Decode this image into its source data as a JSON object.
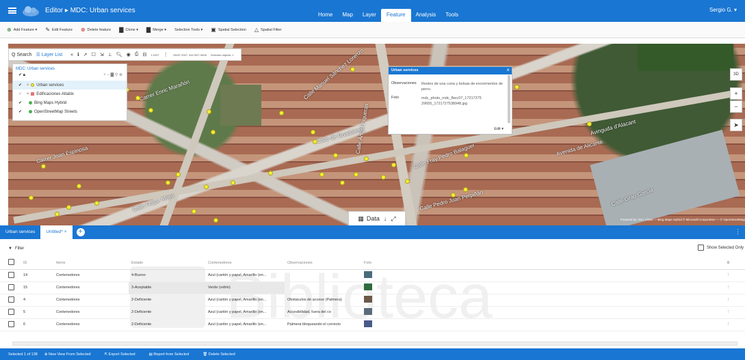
{
  "topbar": {
    "breadcrumb": "Editor ▸ MDC: Urban services",
    "nav": [
      "Home",
      "Map",
      "Layer",
      "Feature",
      "Analysis",
      "Tools"
    ],
    "active_nav": "Feature",
    "user": "Sergio G. ▾"
  },
  "toolbar": [
    {
      "icon": "plus-circle-icon",
      "label": "Add Feature ▾",
      "color": "#2e7d32"
    },
    {
      "icon": "pencil-icon",
      "label": "Edit Feature",
      "color": "#333333"
    },
    {
      "icon": "delete-circle-icon",
      "label": "Delete feature",
      "color": "#d32f2f"
    },
    {
      "icon": "clone-icon",
      "label": "Clone ▾",
      "color": "#333333"
    },
    {
      "icon": "merge-icon",
      "label": "Merge ▾",
      "color": "#333333"
    },
    {
      "icon": "selection-icon",
      "label": "Selection Tools ▾",
      "color": "#333333"
    },
    {
      "icon": "spatial-selection-icon",
      "label": "Spatial Selection",
      "color": "#333333"
    },
    {
      "icon": "spatial-filter-icon",
      "label": "Spatial Filter",
      "color": "#333333"
    }
  ],
  "maptools": {
    "search": "Q Search",
    "layer_list": "Layer List",
    "scale": "1:2257",
    "coords": "-78497.3307, 4617827.9628",
    "selected_objects": "Selected objects: 1"
  },
  "layer_panel": {
    "title": "MDC: Urban services",
    "layers": [
      {
        "name": "Urban services",
        "checked": true,
        "selected": true,
        "swatch": "#f2f230"
      },
      {
        "name": "Edificaciones Altabix",
        "checked": false,
        "selected": false,
        "swatch": "#e57373"
      },
      {
        "name": "Bing Maps Hybrid",
        "checked": true,
        "selected": false,
        "swatch": "#4caf50"
      },
      {
        "name": "OpenStreetMap Streets",
        "checked": true,
        "selected": false,
        "swatch": "#4caf50"
      }
    ]
  },
  "map_labels": [
    "Carrer Enric Marañón",
    "Calle Manuel Sánchez Lorenzo",
    "Calle Ángel Piqueras",
    "Calle de Guadalete",
    "Carrer Joan Espinosa",
    "Calle Felipe Moya",
    "Calle Fray Pedro Balaguer",
    "Avinguda d'Alacant",
    "Avenida de Alicante",
    "Calle Grau García",
    "Calle Pedro Juan Perpiñán"
  ],
  "popup": {
    "title": "Urban services",
    "rows": [
      {
        "key": "Observaciones",
        "value": "Restos de una cuna y bolsas de excrementos de perro."
      },
      {
        "key": "Foto",
        "value": "mdc_photo_mdc_fbec07_17217275 29655_1721727538948.jpg"
      }
    ],
    "edit": "Edit ▾"
  },
  "right_controls": [
    "3D",
    "+",
    "−",
    "➤"
  ],
  "data_toggle": "Data",
  "attribution": "Powered by: Esri, Chart — Bing Maps Hybrid © Microsoft Corporation — © OpenStreetMap",
  "tabs": {
    "items": [
      "Urban services",
      "Untitled* ×"
    ],
    "active": "Untitled* ×"
  },
  "filter": {
    "label": "Filter",
    "show_selected": "Show Selected Only"
  },
  "table": {
    "columns": [
      "ID",
      "Items",
      "Estado",
      "Contenedores",
      "Observaciones",
      "Foto"
    ],
    "rows": [
      {
        "id": "14",
        "items": "Contenedores",
        "estado": "4-Bueno",
        "contenedores": "Azul (cartón y papel, Amarillo (en...",
        "observaciones": "",
        "foto_color": "#4a6b7a"
      },
      {
        "id": "15",
        "items": "Contenedores",
        "estado": "3-Aceptable",
        "contenedores": "Verde (vidrio)",
        "observaciones": "",
        "foto_color": "#2e6b3e"
      },
      {
        "id": "4",
        "items": "Contenedores",
        "estado": "2-Deficiente",
        "contenedores": "Azul (cartón y papel, Amarillo (en...",
        "observaciones": "Obstaculos de acceso (Palmera)",
        "foto_color": "#6b5a4a"
      },
      {
        "id": "5",
        "items": "Contenedores",
        "estado": "2-Deficiente",
        "contenedores": "Azul (cartón y papel, Amarillo (en...",
        "observaciones": "Accesibilidad, fuera del co",
        "foto_color": "#5a6b7a"
      },
      {
        "id": "6",
        "items": "Contenedores",
        "estado": "2-Deficiente",
        "contenedores": "Azul (cartón y papel, Amarillo (en...",
        "observaciones": "Palmera bloqueando el correcto",
        "foto_color": "#4a5a8a"
      }
    ]
  },
  "status": {
    "selected": "Selected 1 of 138",
    "actions": [
      "New View From Selected",
      "Export Selected",
      "Report from Selected",
      "Delete Selected"
    ]
  },
  "colors": {
    "primary": "#1976d2",
    "feature_point": "#f2f230"
  }
}
